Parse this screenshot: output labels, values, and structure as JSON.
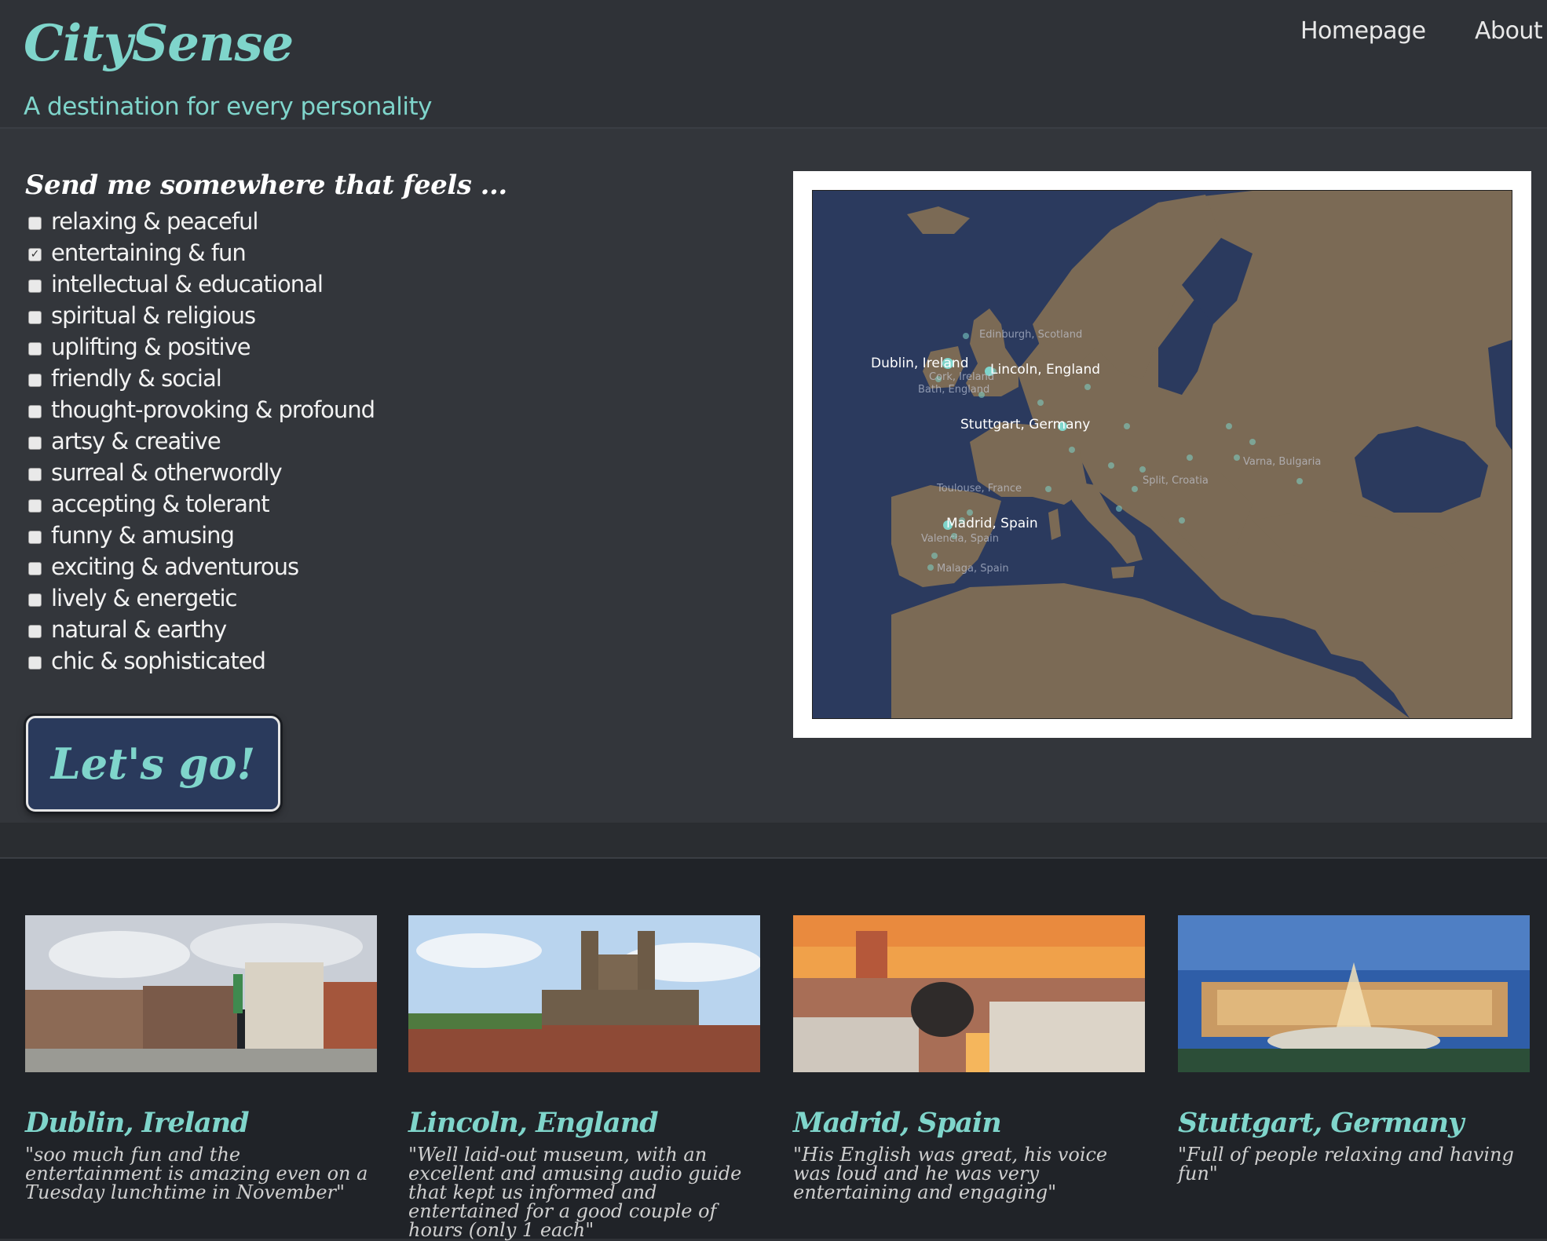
{
  "header": {
    "logo": "CitySense",
    "tagline": "A destination for every personality",
    "nav": {
      "home": "Homepage",
      "about": "About"
    }
  },
  "form": {
    "prompt": "Send me somewhere that feels ...",
    "options": [
      {
        "label": "relaxing & peaceful",
        "checked": false
      },
      {
        "label": "entertaining & fun",
        "checked": true
      },
      {
        "label": "intellectual & educational",
        "checked": false
      },
      {
        "label": "spiritual & religious",
        "checked": false
      },
      {
        "label": "uplifting & positive",
        "checked": false
      },
      {
        "label": "friendly & social",
        "checked": false
      },
      {
        "label": "thought-provoking & profound",
        "checked": false
      },
      {
        "label": "artsy & creative",
        "checked": false
      },
      {
        "label": "surreal & otherwordly",
        "checked": false
      },
      {
        "label": "accepting & tolerant",
        "checked": false
      },
      {
        "label": "funny & amusing",
        "checked": false
      },
      {
        "label": "exciting & adventurous",
        "checked": false
      },
      {
        "label": "lively & energetic",
        "checked": false
      },
      {
        "label": "natural & earthy",
        "checked": false
      },
      {
        "label": "chic & sophisticated",
        "checked": false
      }
    ],
    "submit_label": "Let's go!"
  },
  "map": {
    "highlighted_cities": [
      "Dublin, Ireland",
      "Lincoln, England",
      "Stuttgart, Germany",
      "Madrid, Spain"
    ],
    "secondary_cities": [
      "Edinburgh, Scotland",
      "Varna, Bulgaria",
      "Split, Croatia",
      "Valencia, Spain",
      "Malaga, Spain",
      "Toulouse, France",
      "Cork, Ireland",
      "Bath, England"
    ],
    "colors": {
      "sea": "#2b3a5e",
      "land": "#7b6a55",
      "point": "#7fd5cb"
    }
  },
  "results": [
    {
      "city": "Dublin, Ireland",
      "quote": "\"soo much fun and the entertainment is amazing even on a Tuesday lunchtime in November\""
    },
    {
      "city": "Lincoln, England",
      "quote": "\"Well laid-out museum, with an excellent and amusing audio guide that kept us informed and entertained for a good couple of hours (only 1 each\""
    },
    {
      "city": "Madrid, Spain",
      "quote": "\"His English was great, his voice was loud and he was very entertaining and engaging\""
    },
    {
      "city": "Stuttgart, Germany",
      "quote": "\"Full of people relaxing and having fun\""
    }
  ]
}
